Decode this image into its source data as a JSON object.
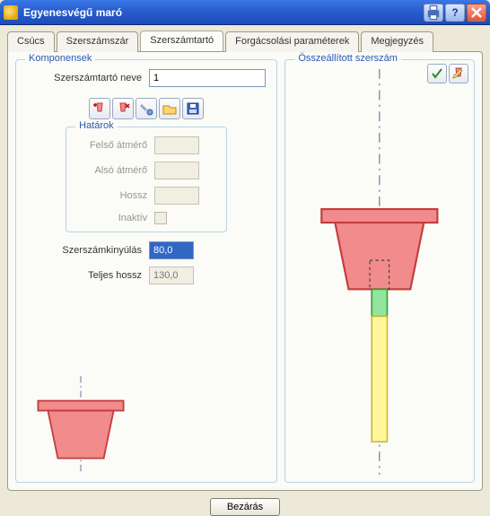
{
  "window": {
    "title": "Egyenesvégű maró"
  },
  "tabs": {
    "csucs": "Csúcs",
    "szerszamszar": "Szerszámszár",
    "szerszamtarto": "Szerszámtartó",
    "forgacsolasi": "Forgácsolási paraméterek",
    "megjegyzes": "Megjegyzés"
  },
  "groups": {
    "komponensek": "Komponensek",
    "hatarok": "Határok",
    "osszeallitott": "Összeállított szerszám"
  },
  "labels": {
    "szerszamtarto_neve": "Szerszámtartó neve",
    "felso_atmero": "Felső átmérő",
    "also_atmero": "Alsó átmérő",
    "hossz": "Hossz",
    "inaktiv": "Inaktív",
    "szerszamkinyulas": "Szerszámkinyúlás",
    "teljes_hossz": "Teljes hossz"
  },
  "values": {
    "szerszamtarto_neve": "1",
    "felso_atmero": "",
    "also_atmero": "",
    "hossz": "",
    "inaktiv": false,
    "szerszamkinyulas": "80,0",
    "teljes_hossz": "130,0"
  },
  "buttons": {
    "bezaras": "Bezárás"
  },
  "icons": {
    "toolbar": [
      "add-holder-icon",
      "delete-holder-icon",
      "tools-icon",
      "browse-icon",
      "save-icon"
    ],
    "right": [
      "check-icon",
      "edit-tool-icon"
    ]
  },
  "colors": {
    "holder_fill": "#f28b8b",
    "holder_stroke": "#c43d3d",
    "shaft_fill": "#fff79a",
    "tip_fill": "#92e59c",
    "axis": "#5b6aa0"
  }
}
